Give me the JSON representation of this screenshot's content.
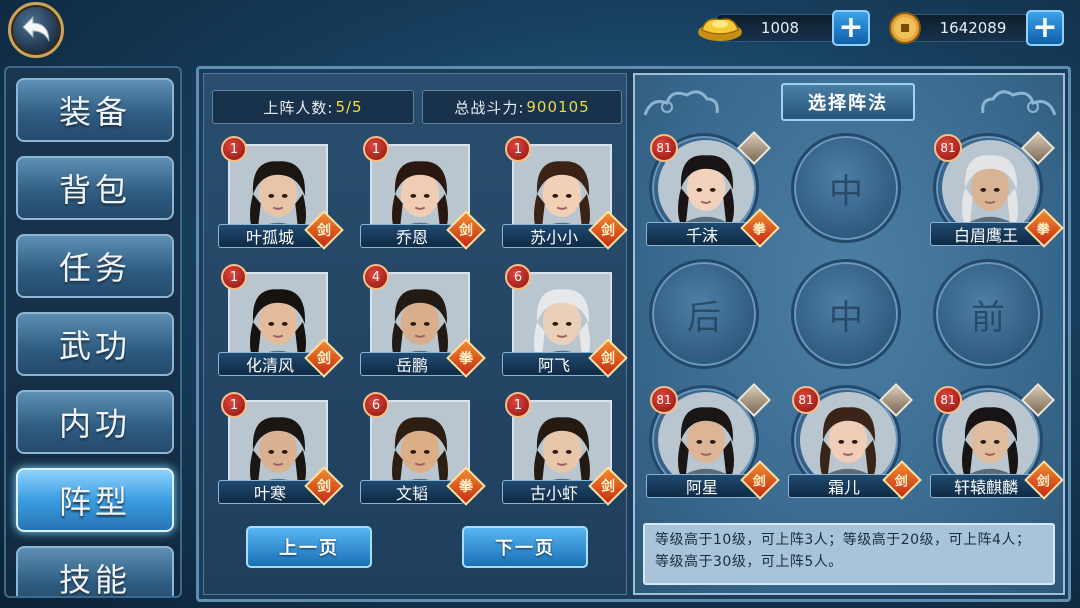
{
  "currency": {
    "gold": {
      "icon": "gold-ingot-icon",
      "value": "1008"
    },
    "coin": {
      "icon": "copper-coin-icon",
      "value": "1642089"
    },
    "plus_label": "+"
  },
  "sidebar": {
    "items": [
      {
        "label": "装备",
        "active": false
      },
      {
        "label": "背包",
        "active": false
      },
      {
        "label": "任务",
        "active": false
      },
      {
        "label": "武功",
        "active": false
      },
      {
        "label": "内功",
        "active": false
      },
      {
        "label": "阵型",
        "active": true
      },
      {
        "label": "技能",
        "active": false
      }
    ]
  },
  "stats": {
    "count_label": "上阵人数:",
    "count_value": "5/5",
    "power_label": "总战斗力:",
    "power_value": "900105"
  },
  "heroes": [
    {
      "name": "叶孤城",
      "level": "1",
      "type": "剑"
    },
    {
      "name": "乔恩",
      "level": "1",
      "type": "剑"
    },
    {
      "name": "苏小小",
      "level": "1",
      "type": "剑"
    },
    {
      "name": "化清风",
      "level": "1",
      "type": "剑"
    },
    {
      "name": "岳鹏",
      "level": "4",
      "type": "拳"
    },
    {
      "name": "阿飞",
      "level": "6",
      "type": "剑"
    },
    {
      "name": "叶寒",
      "level": "1",
      "type": "剑"
    },
    {
      "name": "文韬",
      "level": "6",
      "type": "拳"
    },
    {
      "name": "古小虾",
      "level": "1",
      "type": "剑"
    }
  ],
  "pagination": {
    "prev": "上一页",
    "next": "下一页"
  },
  "formation": {
    "title": "选择阵法",
    "slots": [
      {
        "name": "千沫",
        "level": "81",
        "type": "拳",
        "empty": false
      },
      {
        "mark": "中",
        "empty": true
      },
      {
        "name": "白眉鹰王",
        "level": "81",
        "type": "拳",
        "empty": false
      },
      {
        "mark": "后",
        "empty": true
      },
      {
        "mark": "中",
        "empty": true
      },
      {
        "mark": "前",
        "empty": true
      },
      {
        "name": "阿星",
        "level": "81",
        "type": "剑",
        "empty": false
      },
      {
        "name": "霜儿",
        "level": "81",
        "type": "剑",
        "empty": false
      },
      {
        "name": "轩辕麒麟",
        "level": "81",
        "type": "剑",
        "empty": false
      }
    ],
    "info": "等级高于10级，可上阵3人；等级高于20级，可上阵4人；等级高于30级，可上阵5人。"
  },
  "colors": {
    "accent": "#3aa3ea",
    "gold": "#f3d84a",
    "badge": "#c72a16"
  }
}
